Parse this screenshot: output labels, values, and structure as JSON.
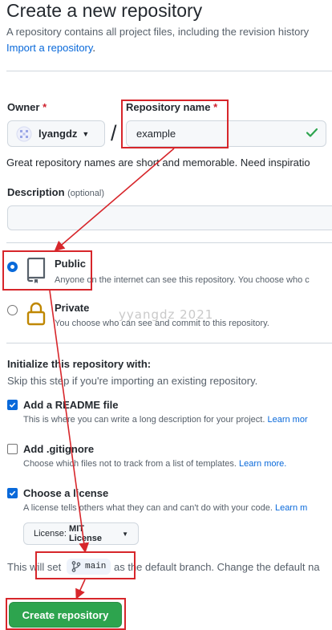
{
  "header": {
    "title": "Create a new repository",
    "description": "A repository contains all project files, including the revision history",
    "import_link": "Import a repository",
    "import_suffix": "."
  },
  "owner": {
    "label": "Owner",
    "required_mark": "*",
    "value": "lyangdz"
  },
  "repo_name": {
    "label": "Repository name",
    "required_mark": "*",
    "value": "example",
    "separator": "/",
    "hint": "Great repository names are short and memorable. Need inspiratio"
  },
  "description_field": {
    "label": "Description",
    "optional": "(optional)",
    "value": ""
  },
  "visibility": {
    "public": {
      "title": "Public",
      "desc": "Anyone on the internet can see this repository. You choose who c",
      "selected": true
    },
    "private": {
      "title": "Private",
      "desc": "You choose who can see and commit to this repository.",
      "selected": false
    }
  },
  "init": {
    "heading": "Initialize this repository with:",
    "subheading": "Skip this step if you're importing an existing repository.",
    "readme": {
      "label": "Add a README file",
      "desc": "This is where you can write a long description for your project.",
      "link": "Learn mor",
      "checked": true
    },
    "gitignore": {
      "label": "Add .gitignore",
      "desc": "Choose which files not to track from a list of templates.",
      "link": "Learn more.",
      "checked": false
    },
    "license": {
      "label": "Choose a license",
      "desc": "A license tells others what they can and can't do with your code.",
      "link": "Learn m",
      "checked": true,
      "dropdown_prefix": "License: ",
      "dropdown_value": "MIT License"
    }
  },
  "branch": {
    "prefix": "This will set",
    "name": "main",
    "suffix": "as the default branch. Change the default na"
  },
  "submit": {
    "label": "Create repository"
  },
  "watermark": "yyangdz 2021",
  "colors": {
    "accent": "#0969da",
    "annotation_red": "#d7262b",
    "submit_green": "#2da44e",
    "check_green": "#2da44e"
  },
  "icons": {
    "owner_avatar": "avatar-icon",
    "valid": "check-icon",
    "public": "repo-book-icon",
    "private": "lock-icon",
    "branch": "git-branch-icon",
    "dropdown": "caret-down-icon"
  }
}
